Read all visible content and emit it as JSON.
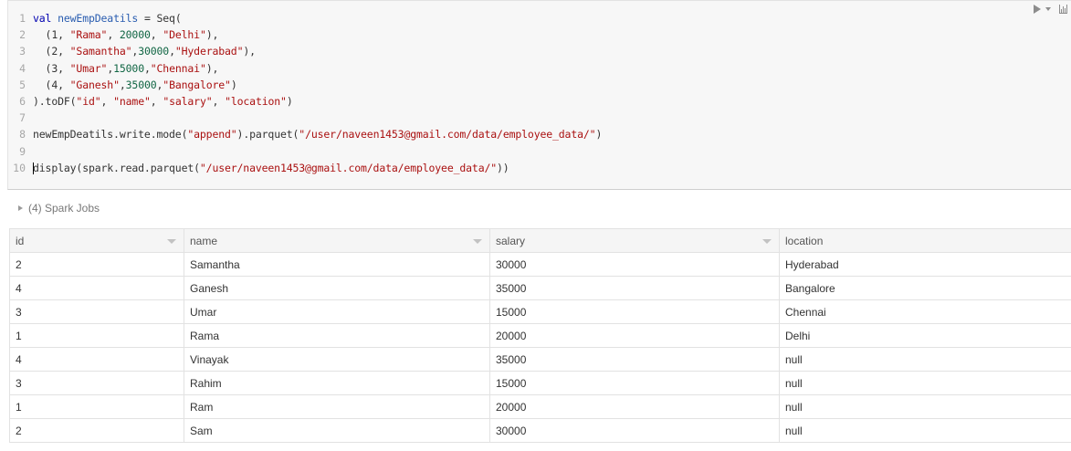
{
  "code": {
    "line_numbers": [
      "1",
      "2",
      "3",
      "4",
      "5",
      "6",
      "7",
      "8",
      "9",
      "10"
    ],
    "l1": {
      "kw": "val",
      "var": "newEmpDeatils",
      "rest": " = Seq("
    },
    "l2": {
      "a": "  (1, ",
      "s1": "\"Rama\"",
      "b": ", ",
      "n": "20000",
      "c": ", ",
      "s2": "\"Delhi\"",
      "d": "),"
    },
    "l3": {
      "a": "  (2, ",
      "s1": "\"Samantha\"",
      "b": ",",
      "n": "30000",
      "c": ",",
      "s2": "\"Hyderabad\"",
      "d": "),"
    },
    "l4": {
      "a": "  (3, ",
      "s1": "\"Umar\"",
      "b": ",",
      "n": "15000",
      "c": ",",
      "s2": "\"Chennai\"",
      "d": "),"
    },
    "l5": {
      "a": "  (4, ",
      "s1": "\"Ganesh\"",
      "b": ",",
      "n": "35000",
      "c": ",",
      "s2": "\"Bangalore\"",
      "d": ")"
    },
    "l6": {
      "a": ").toDF(",
      "s1": "\"id\"",
      "b": ", ",
      "s2": "\"name\"",
      "c": ", ",
      "s3": "\"salary\"",
      "d": ", ",
      "s4": "\"location\"",
      "e": ")"
    },
    "l8": {
      "a": "newEmpDeatils.write.mode(",
      "s1": "\"append\"",
      "b": ").parquet(",
      "s2": "\"/user/naveen1453@gmail.com/data/employee_data/\"",
      "c": ")"
    },
    "l10": {
      "a": "display(spark.read.parquet(",
      "s1": "\"/user/naveen1453@gmail.com/data/employee_data/\"",
      "c": "))"
    }
  },
  "spark_jobs": {
    "label": "(4) Spark Jobs"
  },
  "table": {
    "headers": [
      "id",
      "name",
      "salary",
      "location"
    ],
    "rows": [
      [
        "2",
        "Samantha",
        "30000",
        "Hyderabad"
      ],
      [
        "4",
        "Ganesh",
        "35000",
        "Bangalore"
      ],
      [
        "3",
        "Umar",
        "15000",
        "Chennai"
      ],
      [
        "1",
        "Rama",
        "20000",
        "Delhi"
      ],
      [
        "4",
        "Vinayak",
        "35000",
        "null"
      ],
      [
        "3",
        "Rahim",
        "15000",
        "null"
      ],
      [
        "1",
        "Ram",
        "20000",
        "null"
      ],
      [
        "2",
        "Sam",
        "30000",
        "null"
      ]
    ]
  },
  "icons": {
    "run": "run-icon",
    "chart": "chart-icon",
    "expand": "triangle-right-icon",
    "sort": "sort-down-icon"
  }
}
